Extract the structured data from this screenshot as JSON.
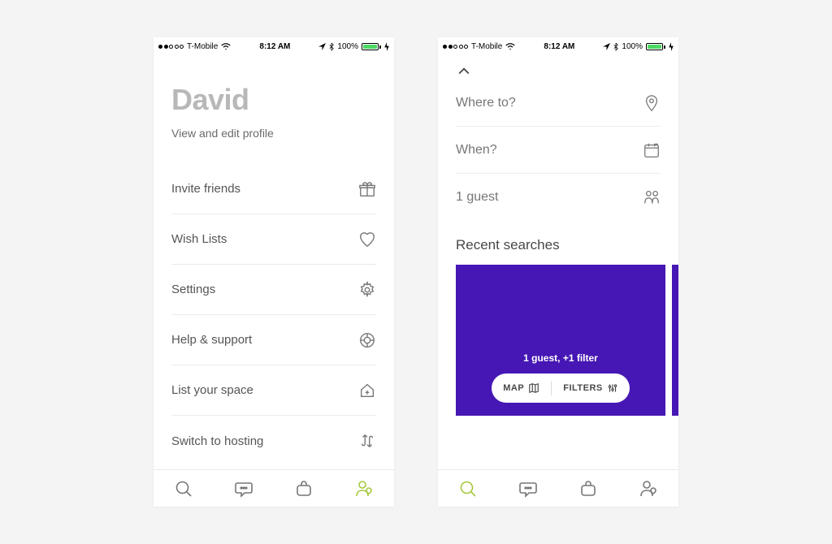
{
  "status": {
    "carrier": "T-Mobile",
    "time": "8:12 AM",
    "battery_pct": "100%"
  },
  "screen1": {
    "name": "David",
    "subtitle": "View and edit profile",
    "menu": {
      "invite": "Invite friends",
      "wish": "Wish Lists",
      "settings": "Settings",
      "help": "Help & support",
      "list_space": "List your space",
      "switch": "Switch to hosting"
    }
  },
  "screen2": {
    "where": "Where to?",
    "when": "When?",
    "guests": "1 guest",
    "recent_title": "Recent searches",
    "card": {
      "subtitle": "1 guest, +1 filter",
      "map": "MAP",
      "filters": "FILTERS"
    }
  },
  "icons": {
    "gift": "gift-icon",
    "heart": "heart-icon",
    "gear": "gear-icon",
    "lifering": "help-icon",
    "house_plus": "house-plus-icon",
    "swap": "swap-icon",
    "location": "location-pin-icon",
    "calendar": "calendar-icon",
    "people": "people-icon",
    "chevron_up": "chevron-up-icon",
    "map": "map-icon",
    "sliders": "sliders-icon",
    "search": "search-icon",
    "chat": "chat-icon",
    "bag": "bag-icon",
    "profile": "profile-icon"
  }
}
